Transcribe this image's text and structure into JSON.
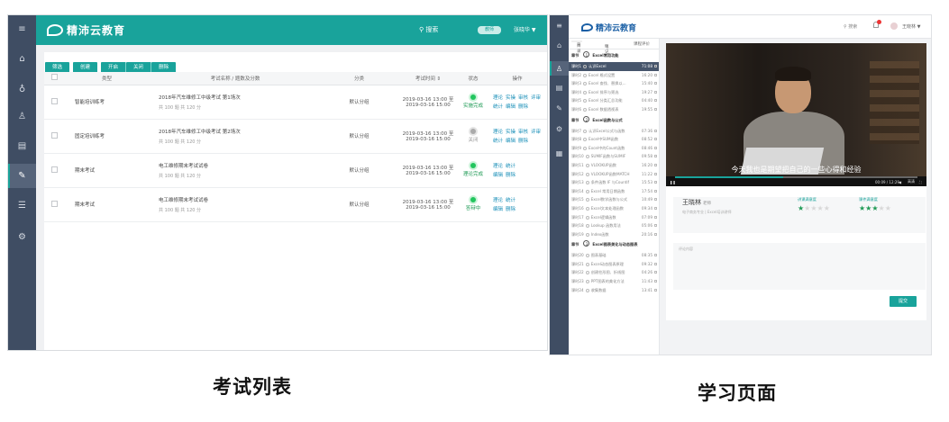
{
  "left": {
    "logo": "精沛云教育",
    "search_label": "搜索",
    "badge": "教师",
    "user": "张晓华 ▼",
    "buttons": [
      "筛选",
      "创建",
      "开启",
      "关闭",
      "删除"
    ],
    "columns": [
      "类型",
      "考试名称 / 题数及分数",
      "分类",
      "考试时间 ⇕",
      "状态",
      "操作"
    ],
    "rows": [
      {
        "type": "智能培训练考",
        "title": "2018年汽车维修工中级考试 第1场次",
        "meta": "共 100 题  共 120 分",
        "category": "默认分组",
        "time1": "2019-03-16 13:00 至",
        "time2": "2019-03-16 15:00",
        "status": "实施完成",
        "status_color": "green",
        "ops1": [
          "理论",
          "实操",
          "审核",
          "评审"
        ],
        "ops2": [
          "统计",
          "编辑",
          "删除"
        ]
      },
      {
        "type": "固定培训练考",
        "title": "2018年汽车维修工中级考试 第2场次",
        "meta": "共 100 题  共 120 分",
        "category": "默认分组",
        "time1": "2019-03-16 13:00 至",
        "time2": "2019-03-16 15:00",
        "status": "关闭",
        "status_color": "gray",
        "ops1": [
          "理论",
          "实操",
          "审核",
          "评审"
        ],
        "ops2": [
          "统计",
          "编辑",
          "删除"
        ]
      },
      {
        "type": "期末考试",
        "title": "电工维修期末考试试卷",
        "meta": "共 100 题  共 120 分",
        "category": "默认分组",
        "time1": "2019-03-16 13:00 至",
        "time2": "2019-03-16 15:00",
        "status": "理论完成",
        "status_color": "green",
        "ops1": [
          "理论",
          "统计"
        ],
        "ops2": [
          "编辑",
          "删除"
        ]
      },
      {
        "type": "期末考试",
        "title": "电工维修期末考试试卷",
        "meta": "共 100 题  共 120 分",
        "category": "默认分组",
        "time1": "2019-03-16 13:00 至",
        "time2": "2019-03-16 15:00",
        "status": "答辩中",
        "status_color": "green",
        "ops1": [
          "理论",
          "统计"
        ],
        "ops2": [
          "编辑",
          "删除"
        ]
      }
    ],
    "caption": "考试列表"
  },
  "right": {
    "logo": "精沛云教育",
    "search_label": "搜索",
    "user": "王晓林 ▼",
    "tabs": [
      "目录",
      "笔记",
      "课程评价"
    ],
    "chapters": [
      {
        "label": "章节",
        "num": "1",
        "title": "Excel常用功能",
        "lessons": [
          {
            "label": "课时1",
            "name": "认识Excel",
            "time": "71:08",
            "current": true
          },
          {
            "label": "课时2",
            "name": "Excel 格式设置",
            "time": "16:20"
          },
          {
            "label": "课时3",
            "name": "Excel 查找、替换以...",
            "time": "15:40"
          },
          {
            "label": "课时4",
            "name": "Excel 排序与筛选",
            "time": "19:27"
          },
          {
            "label": "课时5",
            "name": "Excel 分类汇总功能",
            "time": "04:40"
          },
          {
            "label": "课时6",
            "name": "Excel 数据透视表",
            "time": "19:55"
          }
        ]
      },
      {
        "label": "章节",
        "num": "2",
        "title": "Excel函数与公式",
        "lessons": [
          {
            "label": "课时7",
            "name": "认识Excel公式与函数",
            "time": "07:36"
          },
          {
            "label": "课时8",
            "name": "Excel中SUM函数",
            "time": "08:52"
          },
          {
            "label": "课时9",
            "name": "Excel中的Count函数",
            "time": "08:46"
          },
          {
            "label": "课时10",
            "name": "SUMIF函数与SUMIF",
            "time": "09:58"
          },
          {
            "label": "课时11",
            "name": "VLOOKUP函数",
            "time": "16:20"
          },
          {
            "label": "课时12",
            "name": "VLOOKUP函数MATCH",
            "time": "11:22"
          },
          {
            "label": "课时13",
            "name": "条件函数 IF 与Countif",
            "time": "15:53"
          },
          {
            "label": "课时14",
            "name": "Excel 常用日期函数",
            "time": "17:54"
          },
          {
            "label": "课时15",
            "name": "Excel数学函数与公式",
            "time": "10:49"
          },
          {
            "label": "课时16",
            "name": "Excel文本处理函数",
            "time": "09:34"
          },
          {
            "label": "课时17",
            "name": "Excel逻辑函数",
            "time": "07:09"
          },
          {
            "label": "课时18",
            "name": "Lookup 函数用法",
            "time": "05:06"
          },
          {
            "label": "课时19",
            "name": "Index函数",
            "time": "20:16"
          }
        ]
      },
      {
        "label": "章节",
        "num": "3",
        "title": "Excel图表美化与动态图表",
        "lessons": [
          {
            "label": "课时20",
            "name": "图表基础",
            "time": "08:35"
          },
          {
            "label": "课时21",
            "name": "Excel动态图表原理",
            "time": "09:32"
          },
          {
            "label": "课时22",
            "name": "创建柱形图、折线图",
            "time": "04:26"
          },
          {
            "label": "课时23",
            "name": "PPT图表的美化方法",
            "time": "11:43"
          },
          {
            "label": "课时24",
            "name": "收集数据",
            "time": "13:41"
          }
        ]
      }
    ],
    "video": {
      "subtitle": "今天我也是期望把自己的一些心得和经验",
      "time": "00:09 / 12:29",
      "quality": "高清"
    },
    "teacher": {
      "name": "王晓林",
      "role": "老师",
      "desc": "电子商务专业 | Excel培训讲师"
    },
    "rating1": {
      "label": "讲课满意度",
      "stars": 1
    },
    "rating2": {
      "label": "课件满意度",
      "stars": 3
    },
    "comment_placeholder": "评论内容",
    "submit": "提交",
    "caption": "学习页面"
  }
}
